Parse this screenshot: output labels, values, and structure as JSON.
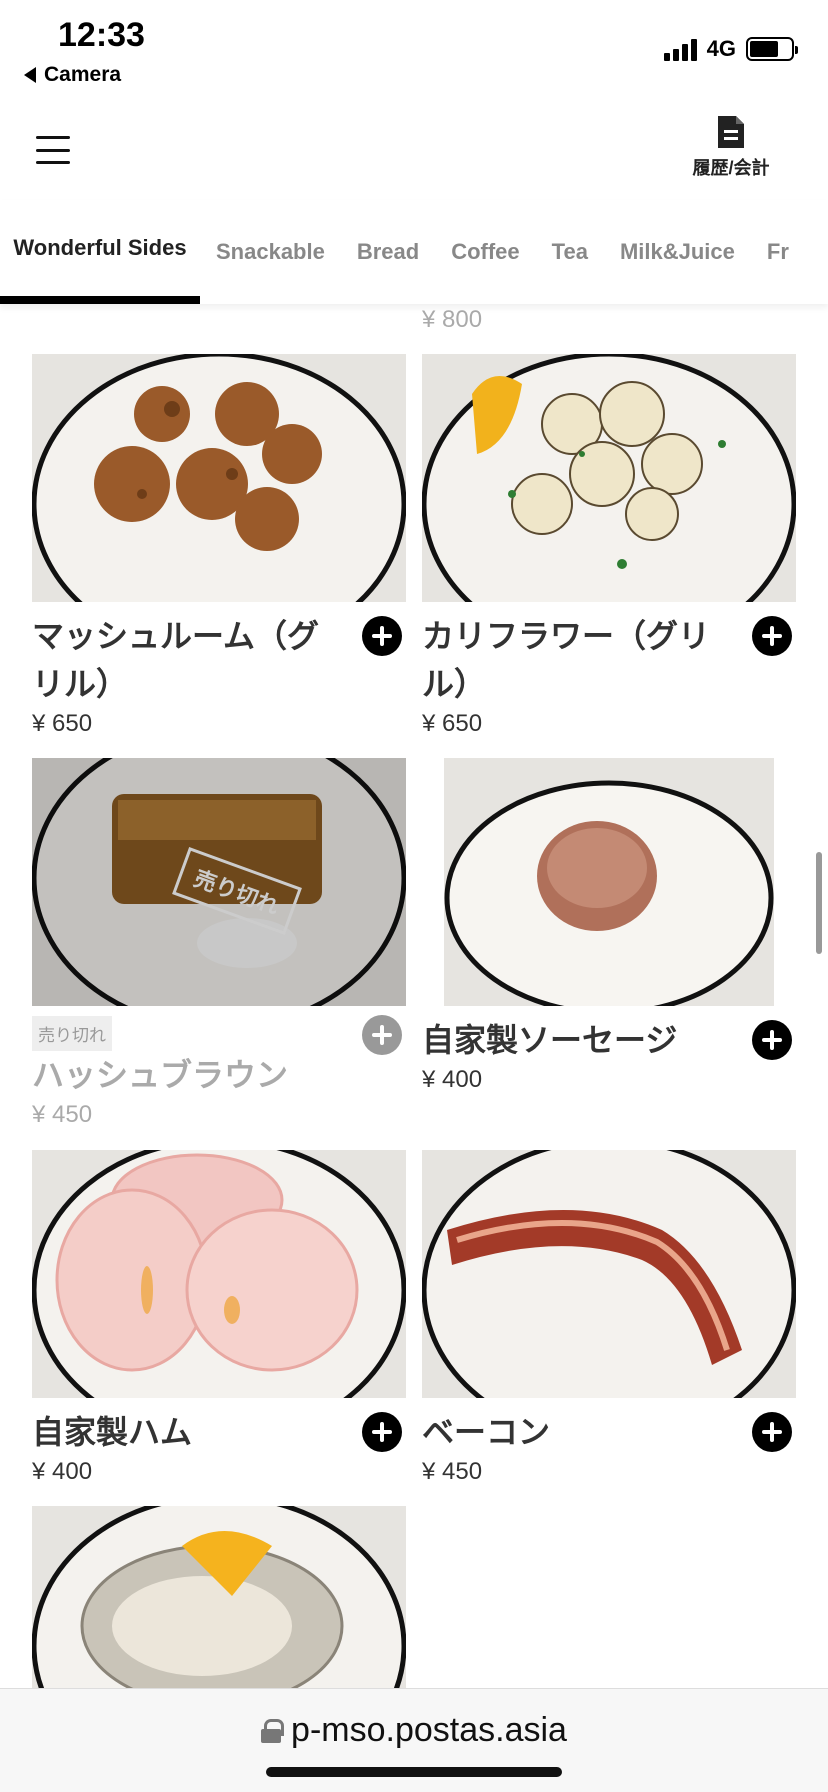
{
  "status": {
    "time": "12:33",
    "back_label": "Camera",
    "network": "4G"
  },
  "header": {
    "history_label": "履歴/会計"
  },
  "tabs": [
    {
      "label": "Wonderful Sides",
      "active": true
    },
    {
      "label": "Snackable"
    },
    {
      "label": "Bread"
    },
    {
      "label": "Coffee"
    },
    {
      "label": "Tea"
    },
    {
      "label": "Milk&Juice"
    },
    {
      "label": "Fr"
    }
  ],
  "prev_price": "¥ 800",
  "items": [
    {
      "name": "マッシュルーム（グリル）",
      "price": "¥ 650",
      "photo": "grilled-mushrooms"
    },
    {
      "name": "カリフラワー（グリル）",
      "price": "¥ 650",
      "photo": "grilled-cauliflower"
    },
    {
      "name": "ハッシュブラウン",
      "price": "¥ 450",
      "photo": "hash-brown",
      "sold_out": true,
      "sold_out_tag": "売り切れ",
      "sold_out_stamp": "売り切れ"
    },
    {
      "name": "自家製ソーセージ",
      "price": "¥ 400",
      "photo": "homemade-sausage"
    },
    {
      "name": "自家製ハム",
      "price": "¥ 400",
      "photo": "homemade-ham"
    },
    {
      "name": "ベーコン",
      "price": "¥ 450",
      "photo": "bacon"
    },
    {
      "name": "",
      "price": "",
      "photo": "oyster"
    }
  ],
  "url_bar": {
    "url": "p-mso.postas.asia"
  }
}
